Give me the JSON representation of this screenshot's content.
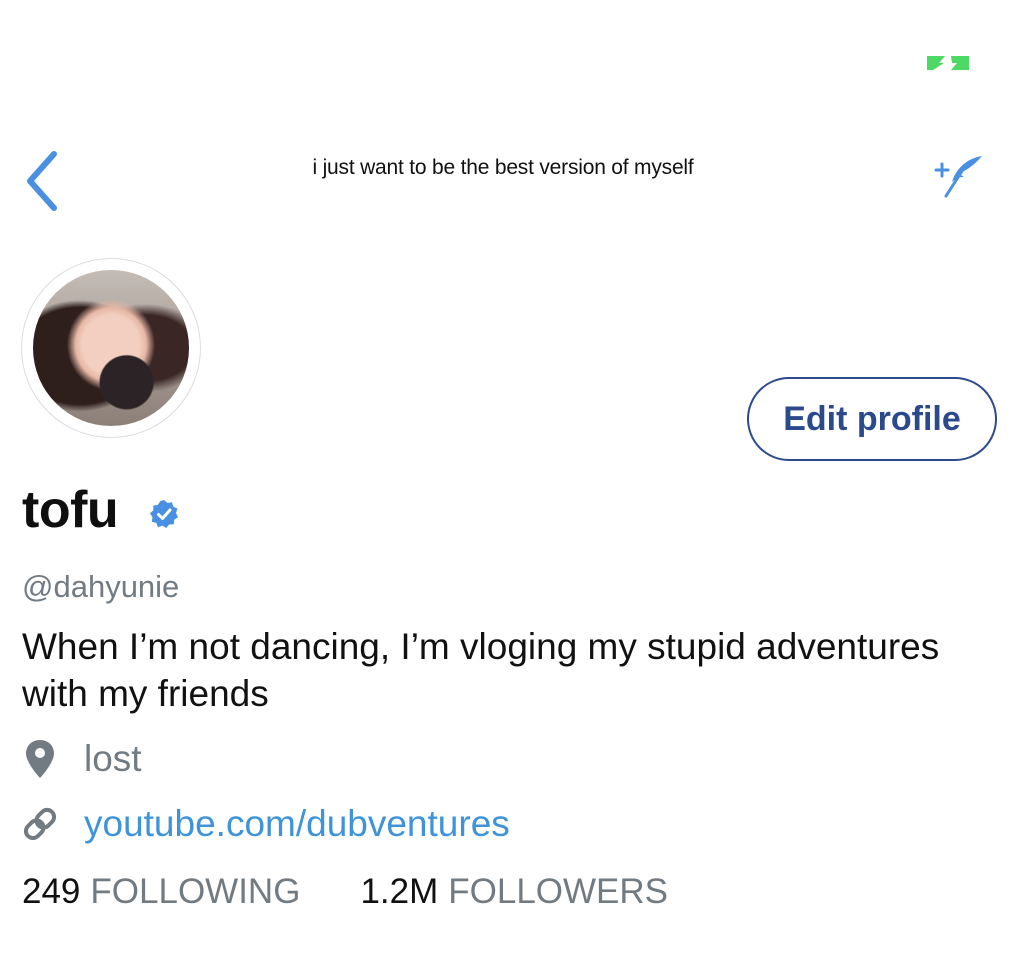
{
  "header": {
    "title": "i just want to be the best version of myself",
    "back_icon": "chevron-left-icon",
    "compose_icon": "compose-feather-icon"
  },
  "status_bar": {
    "battery_icon": "battery-charging-icon",
    "battery_color": "#4cd964"
  },
  "profile": {
    "display_name": "tofu",
    "verified": true,
    "handle": "@dahyunie",
    "bio": "When I’m not dancing, I’m vloging my stupid adventures with my friends",
    "location": "lost",
    "website": "youtube.com/dubventures",
    "edit_label": "Edit profile"
  },
  "stats": {
    "following_count": "249",
    "following_label": "FOLLOWING",
    "followers_count": "1.2M",
    "followers_label": "FOLLOWERS"
  },
  "colors": {
    "accent_blue": "#4a90e2",
    "link_blue": "#3f93d8",
    "secondary_text": "#737b82",
    "edit_border": "#2d4a8a"
  }
}
